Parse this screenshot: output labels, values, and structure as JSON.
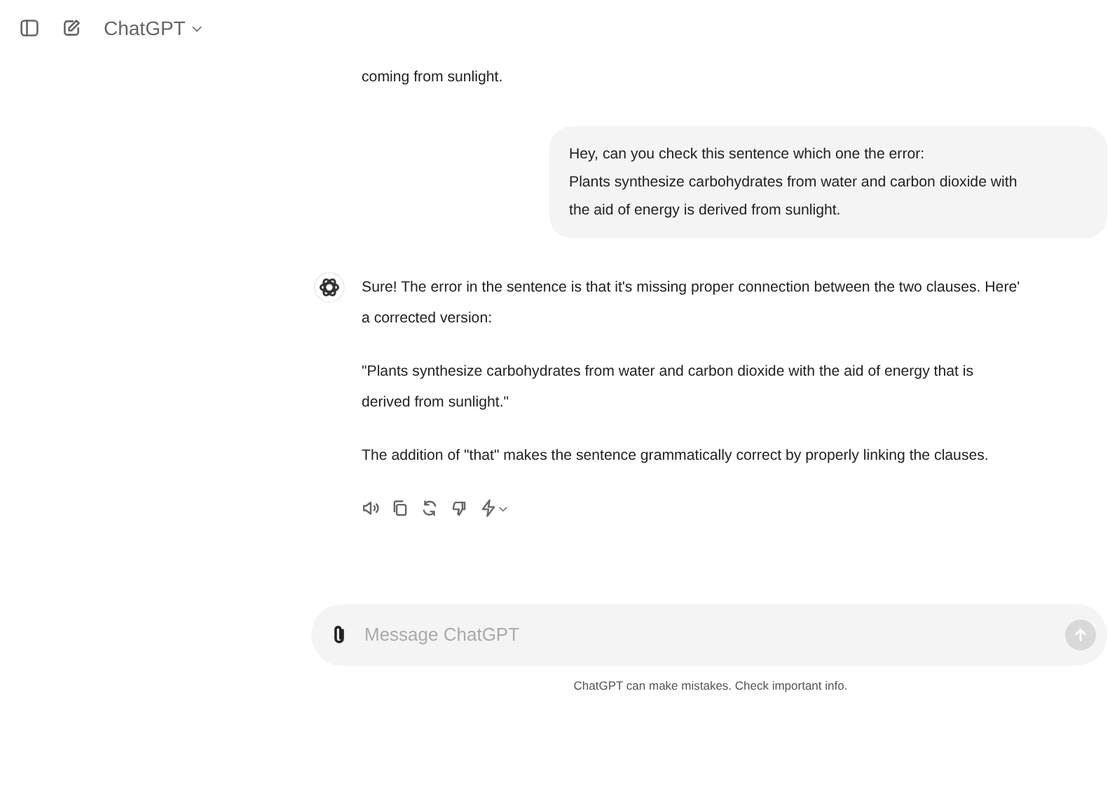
{
  "header": {
    "title": "ChatGPT"
  },
  "messages": [
    {
      "kind": "assistant_tail",
      "text": "coming from sunlight."
    },
    {
      "kind": "user",
      "text": "Hey, can you check this sentence which one the error:\nPlants synthesize carbohydrates from water and carbon dioxide with\nthe aid of energy is derived from sunlight."
    },
    {
      "kind": "assistant",
      "paragraphs": [
        "Sure! The error in the sentence is that it's missing proper connection between the two clauses. Here'\na corrected version:",
        "\"Plants synthesize carbohydrates from water and carbon dioxide with the aid of energy that is\nderived from sunlight.\"",
        "The addition of \"that\" makes the sentence grammatically correct by properly linking the clauses."
      ]
    }
  ],
  "composer": {
    "placeholder": "Message ChatGPT"
  },
  "footer": "ChatGPT can make mistakes. Check important info."
}
